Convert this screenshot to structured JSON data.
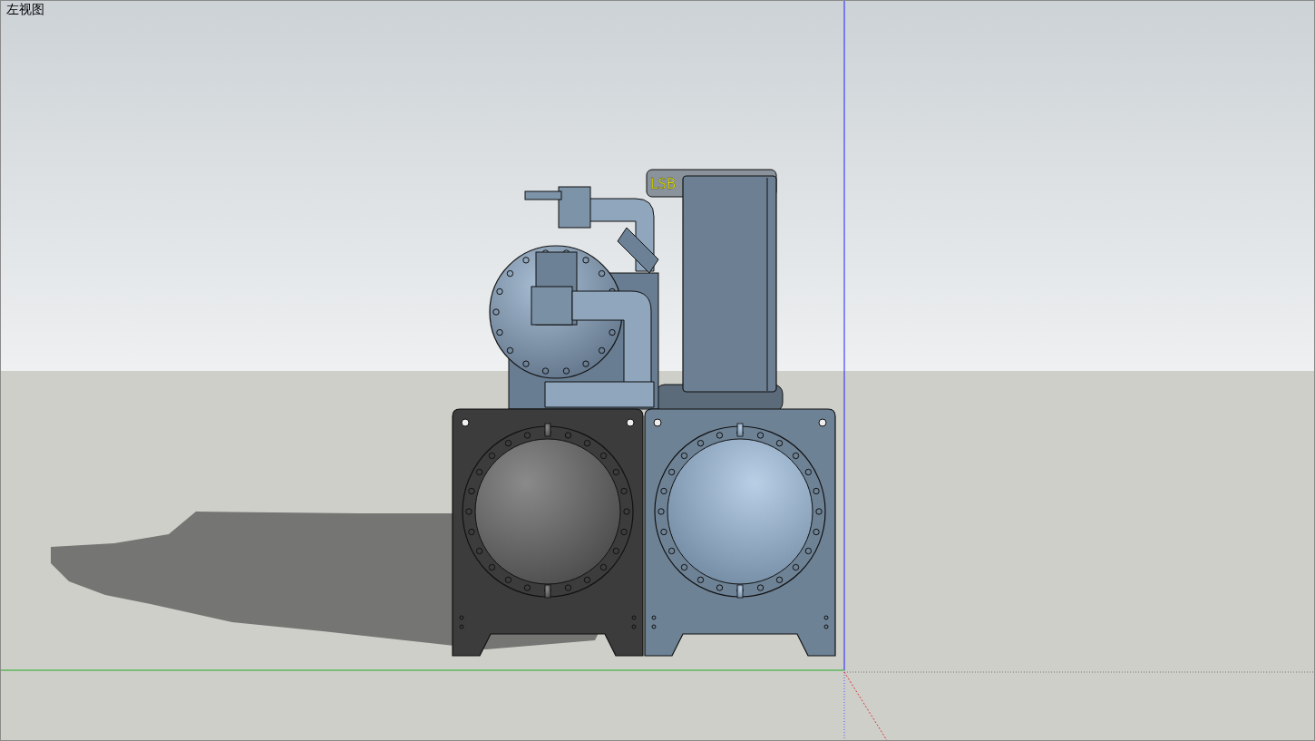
{
  "viewport": {
    "view_name": "左视图"
  },
  "model": {
    "label": "LSB"
  }
}
